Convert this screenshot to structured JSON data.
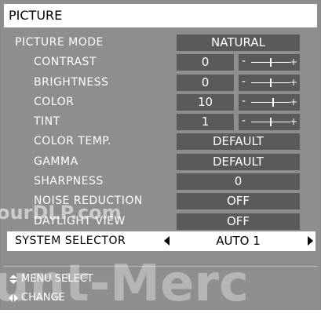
{
  "menu": {
    "title": "PICTURE",
    "items": [
      {
        "label": "PICTURE MODE",
        "sub": false,
        "type": "full",
        "value": "NATURAL"
      },
      {
        "label": "CONTRAST",
        "sub": true,
        "type": "slider",
        "value": "0",
        "level": 0.5
      },
      {
        "label": "BRIGHTNESS",
        "sub": true,
        "type": "slider",
        "value": "0",
        "level": 0.5
      },
      {
        "label": "COLOR",
        "sub": true,
        "type": "slider",
        "value": "10",
        "level": 0.55
      },
      {
        "label": "TINT",
        "sub": true,
        "type": "slider",
        "value": "1",
        "level": 0.5
      },
      {
        "label": "COLOR TEMP.",
        "sub": true,
        "type": "full",
        "value": "DEFAULT"
      },
      {
        "label": "GAMMA",
        "sub": true,
        "type": "full",
        "value": "DEFAULT"
      },
      {
        "label": "SHARPNESS",
        "sub": true,
        "type": "full",
        "value": "0"
      },
      {
        "label": "NOISE REDUCTION",
        "sub": true,
        "type": "full",
        "value": "OFF"
      },
      {
        "label": "DAYLIGHT VIEW",
        "sub": true,
        "type": "full",
        "value": "OFF"
      },
      {
        "label": "SYSTEM SELECTOR",
        "sub": false,
        "type": "selected",
        "value": "AUTO 1"
      }
    ]
  },
  "slider_symbols": {
    "minus": "-",
    "plus": "+"
  },
  "legend": {
    "menu_select": "MENU SELECT",
    "change": "CHANGE"
  },
  "watermark": {
    "left": "ourDLP.com",
    "bottom": "unt-Merc"
  },
  "colors": {
    "panel_bg": "#8e8e8e",
    "value_box": "#5a5a5a",
    "highlight": "#ffffff"
  }
}
